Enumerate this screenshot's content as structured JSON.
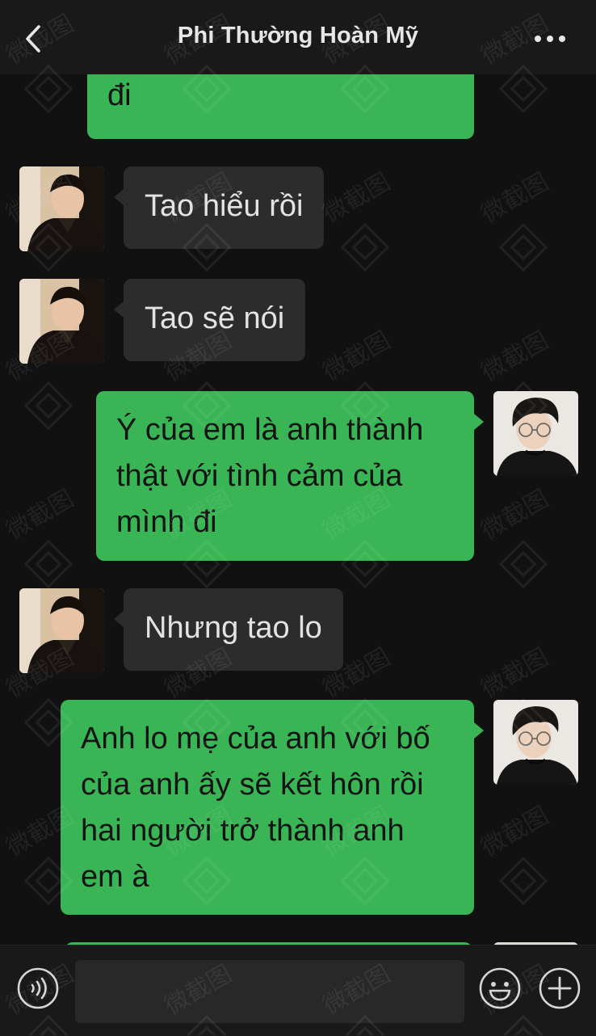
{
  "header": {
    "title": "Phi Thường Hoàn Mỹ",
    "back_icon": "chevron-left-icon",
    "more_icon": "more-dots-icon"
  },
  "messages": [
    {
      "side": "out",
      "text": "đi"
    },
    {
      "side": "in",
      "text": "Tao hiểu rồi"
    },
    {
      "side": "in",
      "text": "Tao sẽ nói"
    },
    {
      "side": "out",
      "text": "Ý của em là anh thành thật với tình cảm của mình đi"
    },
    {
      "side": "in",
      "text": "Nhưng tao lo"
    },
    {
      "side": "out",
      "text": "Anh lo mẹ của anh với bố của anh ấy sẽ kết hôn rồi hai người trở thành anh em à"
    }
  ],
  "composer": {
    "voice_icon": "voice-icon",
    "emoji_icon": "emoji-icon",
    "plus_icon": "plus-icon",
    "input_value": ""
  },
  "watermark_text": "微截图",
  "colors": {
    "background": "#111111",
    "bar": "#191919",
    "incoming_bubble": "#2c2c2c",
    "outgoing_bubble": "#3ab556"
  }
}
